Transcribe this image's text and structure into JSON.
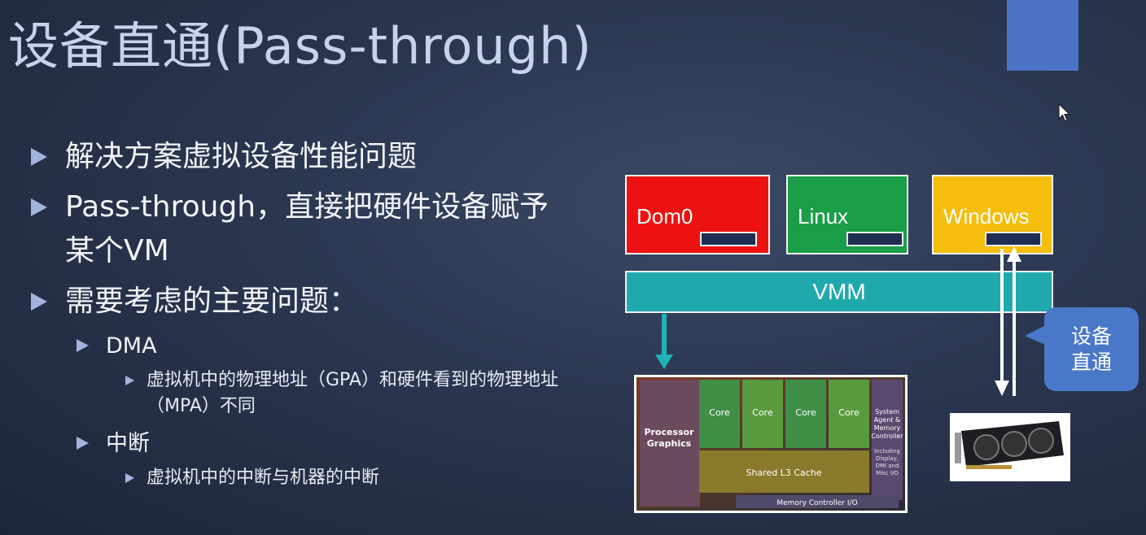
{
  "slide": {
    "title": "设备直通(Pass-through)",
    "bullets": [
      {
        "text": "解决方案虚拟设备性能问题"
      },
      {
        "text": "Pass-through，直接把硬件设备赋予某个VM"
      },
      {
        "text": "需要考虑的主要问题："
      }
    ],
    "sub": [
      {
        "label": "DMA",
        "detail": "虚拟机中的物理地址（GPA）和硬件看到的物理地址（MPA）不同"
      },
      {
        "label": "中断",
        "detail": "虚拟机中的中断与机器的中断"
      }
    ]
  },
  "diagram": {
    "vms": [
      {
        "label": "Dom0",
        "color": "#ee1111"
      },
      {
        "label": "Linux",
        "color": "#1a9e47"
      },
      {
        "label": "Windows",
        "color": "#f5bd0c"
      }
    ],
    "vmm_label": "VMM",
    "vmm_color": "#1fa9ad",
    "callout_text": "设备直通",
    "callout_color": "#4a78c8",
    "cpu_die": {
      "labels": [
        "Processor Graphics",
        "Core",
        "Core",
        "Core",
        "Core",
        "System Agent & Memory Controller",
        "Including Display, DMI and Misc I/O",
        "Shared L3 Cache",
        "Memory Controller I/O"
      ]
    },
    "gpu_icon": "graphics-card-icon"
  },
  "decor": {
    "accent_block_color": "#4d73c4",
    "cursor_icon": "mouse-pointer-icon"
  }
}
